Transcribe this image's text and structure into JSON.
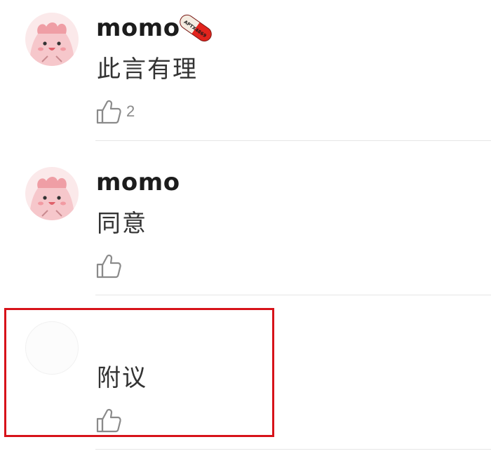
{
  "comments": [
    {
      "username": "momo",
      "text": "此言有理",
      "like_count": "2",
      "avatar_icon": "pink-cartoon-avatar-icon",
      "badge_icon": "pill-capsule-badge-icon",
      "badge_text": "APTX4869"
    },
    {
      "username": "momo",
      "text": "同意",
      "like_count": "",
      "avatar_icon": "pink-cartoon-avatar-icon"
    },
    {
      "username": "",
      "text": "附议",
      "like_count": "",
      "avatar_icon": "blank-avatar-icon"
    }
  ],
  "colors": {
    "highlight_border": "#d7131a",
    "avatar_pink": "#f6c7cb",
    "badge_red": "#e2241d"
  }
}
